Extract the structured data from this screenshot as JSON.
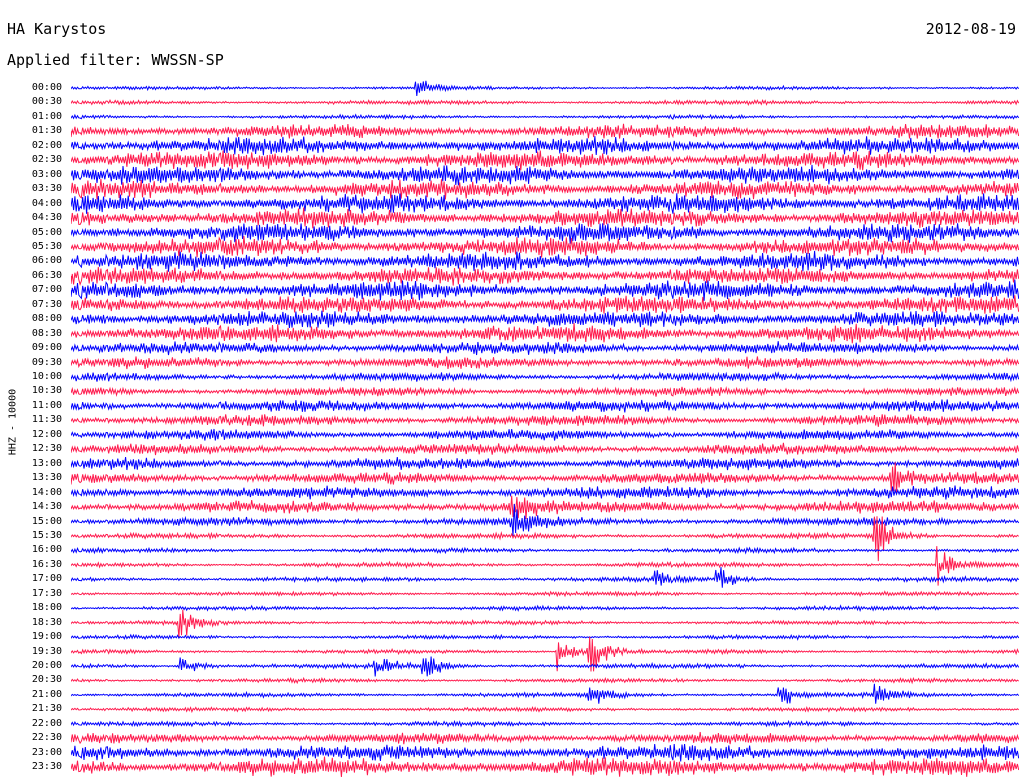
{
  "header": {
    "station": "HA Karystos",
    "date": "2012-08-19",
    "filter": "Applied filter: WWSSN-SP"
  },
  "channel_label": "HHZ - 10000",
  "colors": {
    "even_rows": "#0000ff",
    "odd_rows": "#ff1a4d",
    "background": "#ffffff"
  },
  "chart_data": {
    "type": "line",
    "title": "HA Karystos",
    "subtitle": "Applied filter: WWSSN-SP",
    "ylabel": "HHZ - 10000",
    "xlabel": "",
    "date": "2012-08-19",
    "row_labels": [
      "00:00",
      "00:30",
      "01:00",
      "01:30",
      "02:00",
      "02:30",
      "03:00",
      "03:30",
      "04:00",
      "04:30",
      "05:00",
      "05:30",
      "06:00",
      "06:30",
      "07:00",
      "07:30",
      "08:00",
      "08:30",
      "09:00",
      "09:30",
      "10:00",
      "10:30",
      "11:00",
      "11:30",
      "12:00",
      "12:30",
      "13:00",
      "13:30",
      "14:00",
      "14:30",
      "15:00",
      "15:30",
      "16:00",
      "16:30",
      "17:00",
      "17:30",
      "18:00",
      "18:30",
      "19:00",
      "19:30",
      "20:00",
      "20:30",
      "21:00",
      "21:30",
      "22:00",
      "22:30",
      "23:00",
      "23:30"
    ],
    "row_colors": [
      "blue",
      "red"
    ],
    "amplitude_level": [
      0.08,
      0.12,
      0.1,
      0.65,
      0.85,
      0.9,
      0.95,
      0.9,
      0.95,
      0.95,
      0.95,
      0.95,
      0.9,
      0.9,
      0.95,
      0.9,
      0.85,
      0.9,
      0.6,
      0.5,
      0.35,
      0.4,
      0.55,
      0.5,
      0.5,
      0.5,
      0.55,
      0.55,
      0.6,
      0.6,
      0.35,
      0.2,
      0.15,
      0.15,
      0.15,
      0.12,
      0.12,
      0.12,
      0.12,
      0.12,
      0.14,
      0.12,
      0.14,
      0.12,
      0.14,
      0.5,
      0.8,
      0.9
    ],
    "events": [
      {
        "row": 0,
        "minute": 11,
        "amp": 0.8
      },
      {
        "row": 30,
        "minute": 14,
        "amp": 2.5
      },
      {
        "row": 31,
        "minute": 25.5,
        "amp": 2.8
      },
      {
        "row": 33,
        "minute": 27.5,
        "amp": 1.5
      },
      {
        "row": 34,
        "minute": 20.5,
        "amp": 1.2
      },
      {
        "row": 34,
        "minute": 18.5,
        "amp": 1.0
      },
      {
        "row": 37,
        "minute": 3.5,
        "amp": 1.4
      },
      {
        "row": 39,
        "minute": 15.5,
        "amp": 1.8
      },
      {
        "row": 39,
        "minute": 16.5,
        "amp": 2.0
      },
      {
        "row": 40,
        "minute": 3.5,
        "amp": 1.3
      },
      {
        "row": 40,
        "minute": 9.7,
        "amp": 1.2
      },
      {
        "row": 40,
        "minute": 11.2,
        "amp": 1.5
      },
      {
        "row": 42,
        "minute": 25.5,
        "amp": 1.3
      },
      {
        "row": 42,
        "minute": 16.5,
        "amp": 0.9
      },
      {
        "row": 42,
        "minute": 22.5,
        "amp": 0.9
      },
      {
        "row": 27,
        "minute": 26,
        "amp": 1.6
      },
      {
        "row": 29,
        "minute": 14,
        "amp": 1.4
      }
    ]
  }
}
